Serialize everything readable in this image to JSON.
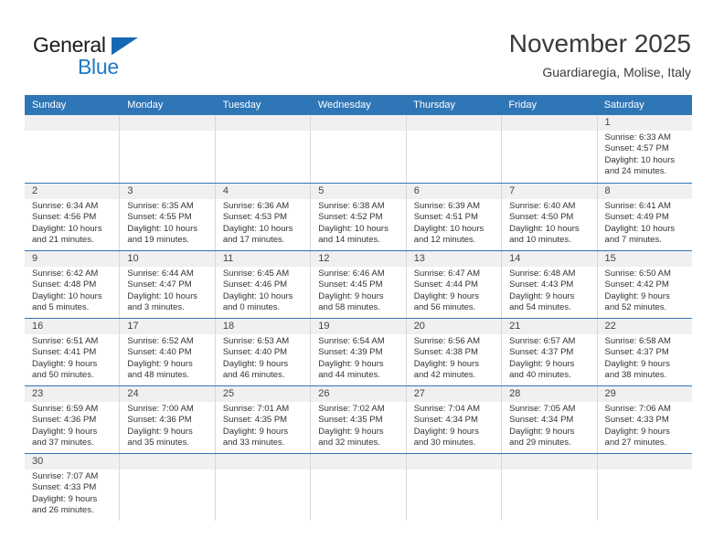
{
  "brand": {
    "name_part1": "General",
    "name_part2": "Blue"
  },
  "header": {
    "title": "November 2025",
    "subtitle": "Guardiaregia, Molise, Italy"
  },
  "colors": {
    "header_blue": "#2f76b6",
    "brand_blue": "#1f7ac4",
    "daynum_band": "#f0f0f0"
  },
  "weekdays": [
    "Sunday",
    "Monday",
    "Tuesday",
    "Wednesday",
    "Thursday",
    "Friday",
    "Saturday"
  ],
  "weeks": [
    [
      {
        "day": "",
        "sunrise": "",
        "sunset": "",
        "daylight_l1": "",
        "daylight_l2": "",
        "empty": true
      },
      {
        "day": "",
        "sunrise": "",
        "sunset": "",
        "daylight_l1": "",
        "daylight_l2": "",
        "empty": true
      },
      {
        "day": "",
        "sunrise": "",
        "sunset": "",
        "daylight_l1": "",
        "daylight_l2": "",
        "empty": true
      },
      {
        "day": "",
        "sunrise": "",
        "sunset": "",
        "daylight_l1": "",
        "daylight_l2": "",
        "empty": true
      },
      {
        "day": "",
        "sunrise": "",
        "sunset": "",
        "daylight_l1": "",
        "daylight_l2": "",
        "empty": true
      },
      {
        "day": "",
        "sunrise": "",
        "sunset": "",
        "daylight_l1": "",
        "daylight_l2": "",
        "empty": true
      },
      {
        "day": "1",
        "sunrise": "Sunrise: 6:33 AM",
        "sunset": "Sunset: 4:57 PM",
        "daylight_l1": "Daylight: 10 hours",
        "daylight_l2": "and 24 minutes.",
        "empty": false
      }
    ],
    [
      {
        "day": "2",
        "sunrise": "Sunrise: 6:34 AM",
        "sunset": "Sunset: 4:56 PM",
        "daylight_l1": "Daylight: 10 hours",
        "daylight_l2": "and 21 minutes.",
        "empty": false
      },
      {
        "day": "3",
        "sunrise": "Sunrise: 6:35 AM",
        "sunset": "Sunset: 4:55 PM",
        "daylight_l1": "Daylight: 10 hours",
        "daylight_l2": "and 19 minutes.",
        "empty": false
      },
      {
        "day": "4",
        "sunrise": "Sunrise: 6:36 AM",
        "sunset": "Sunset: 4:53 PM",
        "daylight_l1": "Daylight: 10 hours",
        "daylight_l2": "and 17 minutes.",
        "empty": false
      },
      {
        "day": "5",
        "sunrise": "Sunrise: 6:38 AM",
        "sunset": "Sunset: 4:52 PM",
        "daylight_l1": "Daylight: 10 hours",
        "daylight_l2": "and 14 minutes.",
        "empty": false
      },
      {
        "day": "6",
        "sunrise": "Sunrise: 6:39 AM",
        "sunset": "Sunset: 4:51 PM",
        "daylight_l1": "Daylight: 10 hours",
        "daylight_l2": "and 12 minutes.",
        "empty": false
      },
      {
        "day": "7",
        "sunrise": "Sunrise: 6:40 AM",
        "sunset": "Sunset: 4:50 PM",
        "daylight_l1": "Daylight: 10 hours",
        "daylight_l2": "and 10 minutes.",
        "empty": false
      },
      {
        "day": "8",
        "sunrise": "Sunrise: 6:41 AM",
        "sunset": "Sunset: 4:49 PM",
        "daylight_l1": "Daylight: 10 hours",
        "daylight_l2": "and 7 minutes.",
        "empty": false
      }
    ],
    [
      {
        "day": "9",
        "sunrise": "Sunrise: 6:42 AM",
        "sunset": "Sunset: 4:48 PM",
        "daylight_l1": "Daylight: 10 hours",
        "daylight_l2": "and 5 minutes.",
        "empty": false
      },
      {
        "day": "10",
        "sunrise": "Sunrise: 6:44 AM",
        "sunset": "Sunset: 4:47 PM",
        "daylight_l1": "Daylight: 10 hours",
        "daylight_l2": "and 3 minutes.",
        "empty": false
      },
      {
        "day": "11",
        "sunrise": "Sunrise: 6:45 AM",
        "sunset": "Sunset: 4:46 PM",
        "daylight_l1": "Daylight: 10 hours",
        "daylight_l2": "and 0 minutes.",
        "empty": false
      },
      {
        "day": "12",
        "sunrise": "Sunrise: 6:46 AM",
        "sunset": "Sunset: 4:45 PM",
        "daylight_l1": "Daylight: 9 hours",
        "daylight_l2": "and 58 minutes.",
        "empty": false
      },
      {
        "day": "13",
        "sunrise": "Sunrise: 6:47 AM",
        "sunset": "Sunset: 4:44 PM",
        "daylight_l1": "Daylight: 9 hours",
        "daylight_l2": "and 56 minutes.",
        "empty": false
      },
      {
        "day": "14",
        "sunrise": "Sunrise: 6:48 AM",
        "sunset": "Sunset: 4:43 PM",
        "daylight_l1": "Daylight: 9 hours",
        "daylight_l2": "and 54 minutes.",
        "empty": false
      },
      {
        "day": "15",
        "sunrise": "Sunrise: 6:50 AM",
        "sunset": "Sunset: 4:42 PM",
        "daylight_l1": "Daylight: 9 hours",
        "daylight_l2": "and 52 minutes.",
        "empty": false
      }
    ],
    [
      {
        "day": "16",
        "sunrise": "Sunrise: 6:51 AM",
        "sunset": "Sunset: 4:41 PM",
        "daylight_l1": "Daylight: 9 hours",
        "daylight_l2": "and 50 minutes.",
        "empty": false
      },
      {
        "day": "17",
        "sunrise": "Sunrise: 6:52 AM",
        "sunset": "Sunset: 4:40 PM",
        "daylight_l1": "Daylight: 9 hours",
        "daylight_l2": "and 48 minutes.",
        "empty": false
      },
      {
        "day": "18",
        "sunrise": "Sunrise: 6:53 AM",
        "sunset": "Sunset: 4:40 PM",
        "daylight_l1": "Daylight: 9 hours",
        "daylight_l2": "and 46 minutes.",
        "empty": false
      },
      {
        "day": "19",
        "sunrise": "Sunrise: 6:54 AM",
        "sunset": "Sunset: 4:39 PM",
        "daylight_l1": "Daylight: 9 hours",
        "daylight_l2": "and 44 minutes.",
        "empty": false
      },
      {
        "day": "20",
        "sunrise": "Sunrise: 6:56 AM",
        "sunset": "Sunset: 4:38 PM",
        "daylight_l1": "Daylight: 9 hours",
        "daylight_l2": "and 42 minutes.",
        "empty": false
      },
      {
        "day": "21",
        "sunrise": "Sunrise: 6:57 AM",
        "sunset": "Sunset: 4:37 PM",
        "daylight_l1": "Daylight: 9 hours",
        "daylight_l2": "and 40 minutes.",
        "empty": false
      },
      {
        "day": "22",
        "sunrise": "Sunrise: 6:58 AM",
        "sunset": "Sunset: 4:37 PM",
        "daylight_l1": "Daylight: 9 hours",
        "daylight_l2": "and 38 minutes.",
        "empty": false
      }
    ],
    [
      {
        "day": "23",
        "sunrise": "Sunrise: 6:59 AM",
        "sunset": "Sunset: 4:36 PM",
        "daylight_l1": "Daylight: 9 hours",
        "daylight_l2": "and 37 minutes.",
        "empty": false
      },
      {
        "day": "24",
        "sunrise": "Sunrise: 7:00 AM",
        "sunset": "Sunset: 4:36 PM",
        "daylight_l1": "Daylight: 9 hours",
        "daylight_l2": "and 35 minutes.",
        "empty": false
      },
      {
        "day": "25",
        "sunrise": "Sunrise: 7:01 AM",
        "sunset": "Sunset: 4:35 PM",
        "daylight_l1": "Daylight: 9 hours",
        "daylight_l2": "and 33 minutes.",
        "empty": false
      },
      {
        "day": "26",
        "sunrise": "Sunrise: 7:02 AM",
        "sunset": "Sunset: 4:35 PM",
        "daylight_l1": "Daylight: 9 hours",
        "daylight_l2": "and 32 minutes.",
        "empty": false
      },
      {
        "day": "27",
        "sunrise": "Sunrise: 7:04 AM",
        "sunset": "Sunset: 4:34 PM",
        "daylight_l1": "Daylight: 9 hours",
        "daylight_l2": "and 30 minutes.",
        "empty": false
      },
      {
        "day": "28",
        "sunrise": "Sunrise: 7:05 AM",
        "sunset": "Sunset: 4:34 PM",
        "daylight_l1": "Daylight: 9 hours",
        "daylight_l2": "and 29 minutes.",
        "empty": false
      },
      {
        "day": "29",
        "sunrise": "Sunrise: 7:06 AM",
        "sunset": "Sunset: 4:33 PM",
        "daylight_l1": "Daylight: 9 hours",
        "daylight_l2": "and 27 minutes.",
        "empty": false
      }
    ],
    [
      {
        "day": "30",
        "sunrise": "Sunrise: 7:07 AM",
        "sunset": "Sunset: 4:33 PM",
        "daylight_l1": "Daylight: 9 hours",
        "daylight_l2": "and 26 minutes.",
        "empty": false
      },
      {
        "day": "",
        "sunrise": "",
        "sunset": "",
        "daylight_l1": "",
        "daylight_l2": "",
        "empty": true
      },
      {
        "day": "",
        "sunrise": "",
        "sunset": "",
        "daylight_l1": "",
        "daylight_l2": "",
        "empty": true
      },
      {
        "day": "",
        "sunrise": "",
        "sunset": "",
        "daylight_l1": "",
        "daylight_l2": "",
        "empty": true
      },
      {
        "day": "",
        "sunrise": "",
        "sunset": "",
        "daylight_l1": "",
        "daylight_l2": "",
        "empty": true
      },
      {
        "day": "",
        "sunrise": "",
        "sunset": "",
        "daylight_l1": "",
        "daylight_l2": "",
        "empty": true
      },
      {
        "day": "",
        "sunrise": "",
        "sunset": "",
        "daylight_l1": "",
        "daylight_l2": "",
        "empty": true
      }
    ]
  ]
}
